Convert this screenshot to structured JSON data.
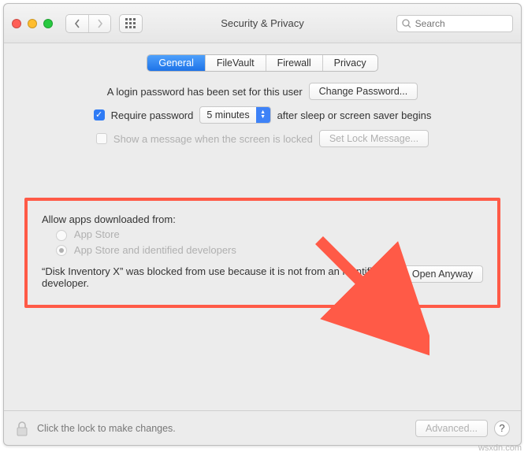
{
  "toolbar": {
    "title": "Security & Privacy",
    "search_placeholder": "Search"
  },
  "tabs": {
    "general": "General",
    "filevault": "FileVault",
    "firewall": "Firewall",
    "privacy": "Privacy"
  },
  "login": {
    "password_set": "A login password has been set for this user",
    "change_password_btn": "Change Password...",
    "require_password": "Require password",
    "delay_value": "5 minutes",
    "after_sleep": "after sleep or screen saver begins",
    "show_message": "Show a message when the screen is locked",
    "set_lock_msg_btn": "Set Lock Message..."
  },
  "allow": {
    "heading": "Allow apps downloaded from:",
    "option_appstore": "App Store",
    "option_identified": "App Store and identified developers",
    "blocked_msg": "“Disk Inventory X” was blocked from use because it is not from an identified developer.",
    "open_anyway_btn": "Open Anyway"
  },
  "footer": {
    "lock_hint": "Click the lock to make changes.",
    "advanced_btn": "Advanced...",
    "help": "?"
  },
  "watermark": "wsxdn.com"
}
